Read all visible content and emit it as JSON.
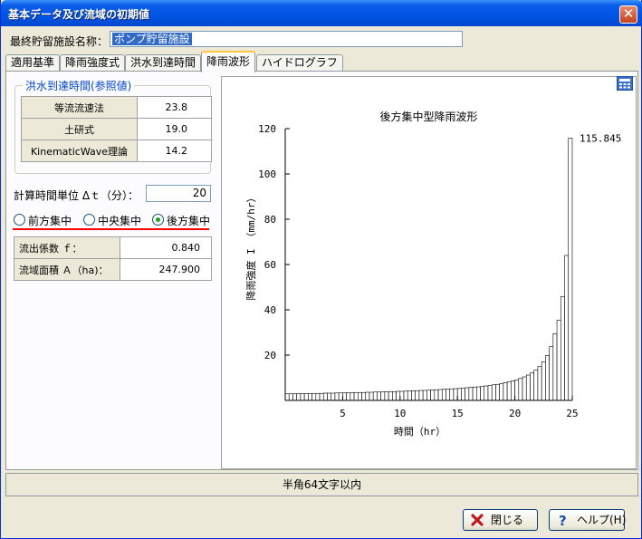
{
  "window": {
    "title": "基本データ及び流域の初期値",
    "close_glyph": "✕"
  },
  "facility": {
    "label": "最終貯留施設名称：",
    "value": "ポンプ貯留施設"
  },
  "tabs": [
    {
      "label": "適用基準"
    },
    {
      "label": "降雨強度式"
    },
    {
      "label": "洪水到達時間"
    },
    {
      "label": "降雨波形"
    },
    {
      "label": "ハイドログラフ"
    }
  ],
  "active_tab_index": 3,
  "group": {
    "title": "洪水到達時間(参照値)",
    "rows": [
      {
        "label": "等流流速法",
        "value": "23.8"
      },
      {
        "label": "土研式",
        "value": "19.0"
      },
      {
        "label": "KinematicWave理論",
        "value": "14.2"
      }
    ]
  },
  "dt": {
    "label": "計算時間単位 Δｔ（分）：",
    "value": "20"
  },
  "radios": [
    {
      "label": "前方集中",
      "checked": false
    },
    {
      "label": "中央集中",
      "checked": false
    },
    {
      "label": "後方集中",
      "checked": true
    }
  ],
  "params": [
    {
      "label": "流出係数 ｆ：",
      "value": "0.840"
    },
    {
      "label": "流域面積 Ａ（ha)：",
      "value": "247.900"
    }
  ],
  "status": {
    "text": "半角64文字以内"
  },
  "buttons": {
    "close": {
      "label": "閉じる",
      "icon": "close-x-icon"
    },
    "help": {
      "label": "ヘルプ(H)",
      "icon": "help-question-icon"
    }
  },
  "accent": {
    "red_underline": "#ff0000",
    "tab_highlight": "#ffc83c",
    "title_blue": "#0054e3"
  },
  "chart_data": {
    "type": "bar",
    "title": "後方集中型降雨波形",
    "xlabel": "時間（hr）",
    "ylabel": "降雨強度 I （mm/hr）",
    "xlim": [
      0,
      25
    ],
    "ylim": [
      0,
      120
    ],
    "xticks": [
      5,
      10,
      15,
      20,
      25
    ],
    "yticks": [
      20,
      40,
      60,
      80,
      100,
      120
    ],
    "bar_width_hr": 0.3333,
    "peak_label": "115.845",
    "values": [
      2.9,
      2.9,
      2.9,
      3.0,
      3.0,
      3.0,
      3.0,
      3.1,
      3.1,
      3.1,
      3.2,
      3.2,
      3.2,
      3.3,
      3.3,
      3.3,
      3.4,
      3.4,
      3.5,
      3.5,
      3.5,
      3.6,
      3.6,
      3.7,
      3.7,
      3.8,
      3.8,
      3.9,
      3.9,
      4.0,
      4.0,
      4.1,
      4.2,
      4.2,
      4.3,
      4.4,
      4.4,
      4.5,
      4.6,
      4.7,
      4.8,
      4.9,
      5.0,
      5.1,
      5.2,
      5.3,
      5.4,
      5.6,
      5.7,
      5.9,
      6.0,
      6.2,
      6.4,
      6.6,
      6.9,
      7.1,
      7.4,
      7.8,
      8.2,
      8.6,
      9.1,
      9.7,
      10.4,
      11.2,
      12.2,
      13.4,
      15.0,
      17.0,
      19.8,
      23.7,
      29.5,
      35.4,
      45.9,
      64.0,
      115.845
    ]
  }
}
